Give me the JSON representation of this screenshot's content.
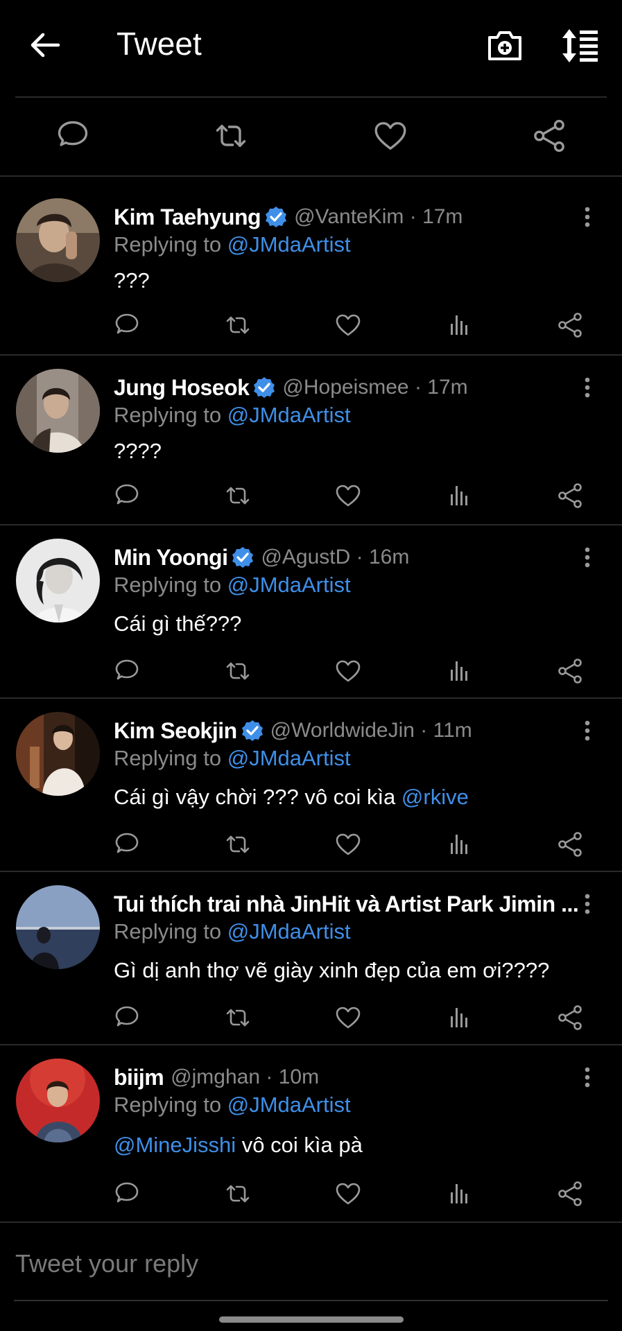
{
  "header": {
    "title": "Tweet"
  },
  "reply_box": {
    "placeholder": "Tweet your reply"
  },
  "colors": {
    "accent": "#3f8fe8",
    "secondary_text": "#8b8b8b",
    "background": "#000000"
  },
  "tweets": [
    {
      "name": "Kim Taehyung",
      "verified": true,
      "handle": "@VanteKim",
      "time": "17m",
      "replying_label": "Replying to",
      "replying_to": "@JMdaArtist",
      "text": "???",
      "mention": "",
      "text_after": ""
    },
    {
      "name": "Jung Hoseok",
      "verified": true,
      "handle": "@Hopeismee",
      "time": "17m",
      "replying_label": "Replying to",
      "replying_to": "@JMdaArtist",
      "text": "????",
      "mention": "",
      "text_after": ""
    },
    {
      "name": "Min Yoongi",
      "verified": true,
      "handle": "@AgustD",
      "time": "16m",
      "replying_label": "Replying to",
      "replying_to": "@JMdaArtist",
      "text": "Cái gì thế???",
      "mention": "",
      "text_after": ""
    },
    {
      "name": "Kim Seokjin",
      "verified": true,
      "handle": "@WorldwideJin",
      "time": "11m",
      "replying_label": "Replying to",
      "replying_to": "@JMdaArtist",
      "text": "Cái gì vậy chời ??? vô coi kìa ",
      "mention": "@rkive",
      "text_after": ""
    },
    {
      "name": "Tui thích trai nhà JinHit và Artist Park Jimin ...",
      "verified": false,
      "handle": "",
      "time": "",
      "replying_label": "Replying to",
      "replying_to": "@JMdaArtist",
      "text": "Gì dị anh thợ vẽ giày xinh đẹp của em ơi????",
      "mention": "",
      "text_after": ""
    },
    {
      "name": "biijm",
      "verified": false,
      "handle": "@jmghan",
      "time": "10m",
      "replying_label": "Replying to",
      "replying_to": "@JMdaArtist",
      "text": "",
      "mention": "@MineJisshi",
      "text_after": " vô coi kìa pà"
    }
  ]
}
